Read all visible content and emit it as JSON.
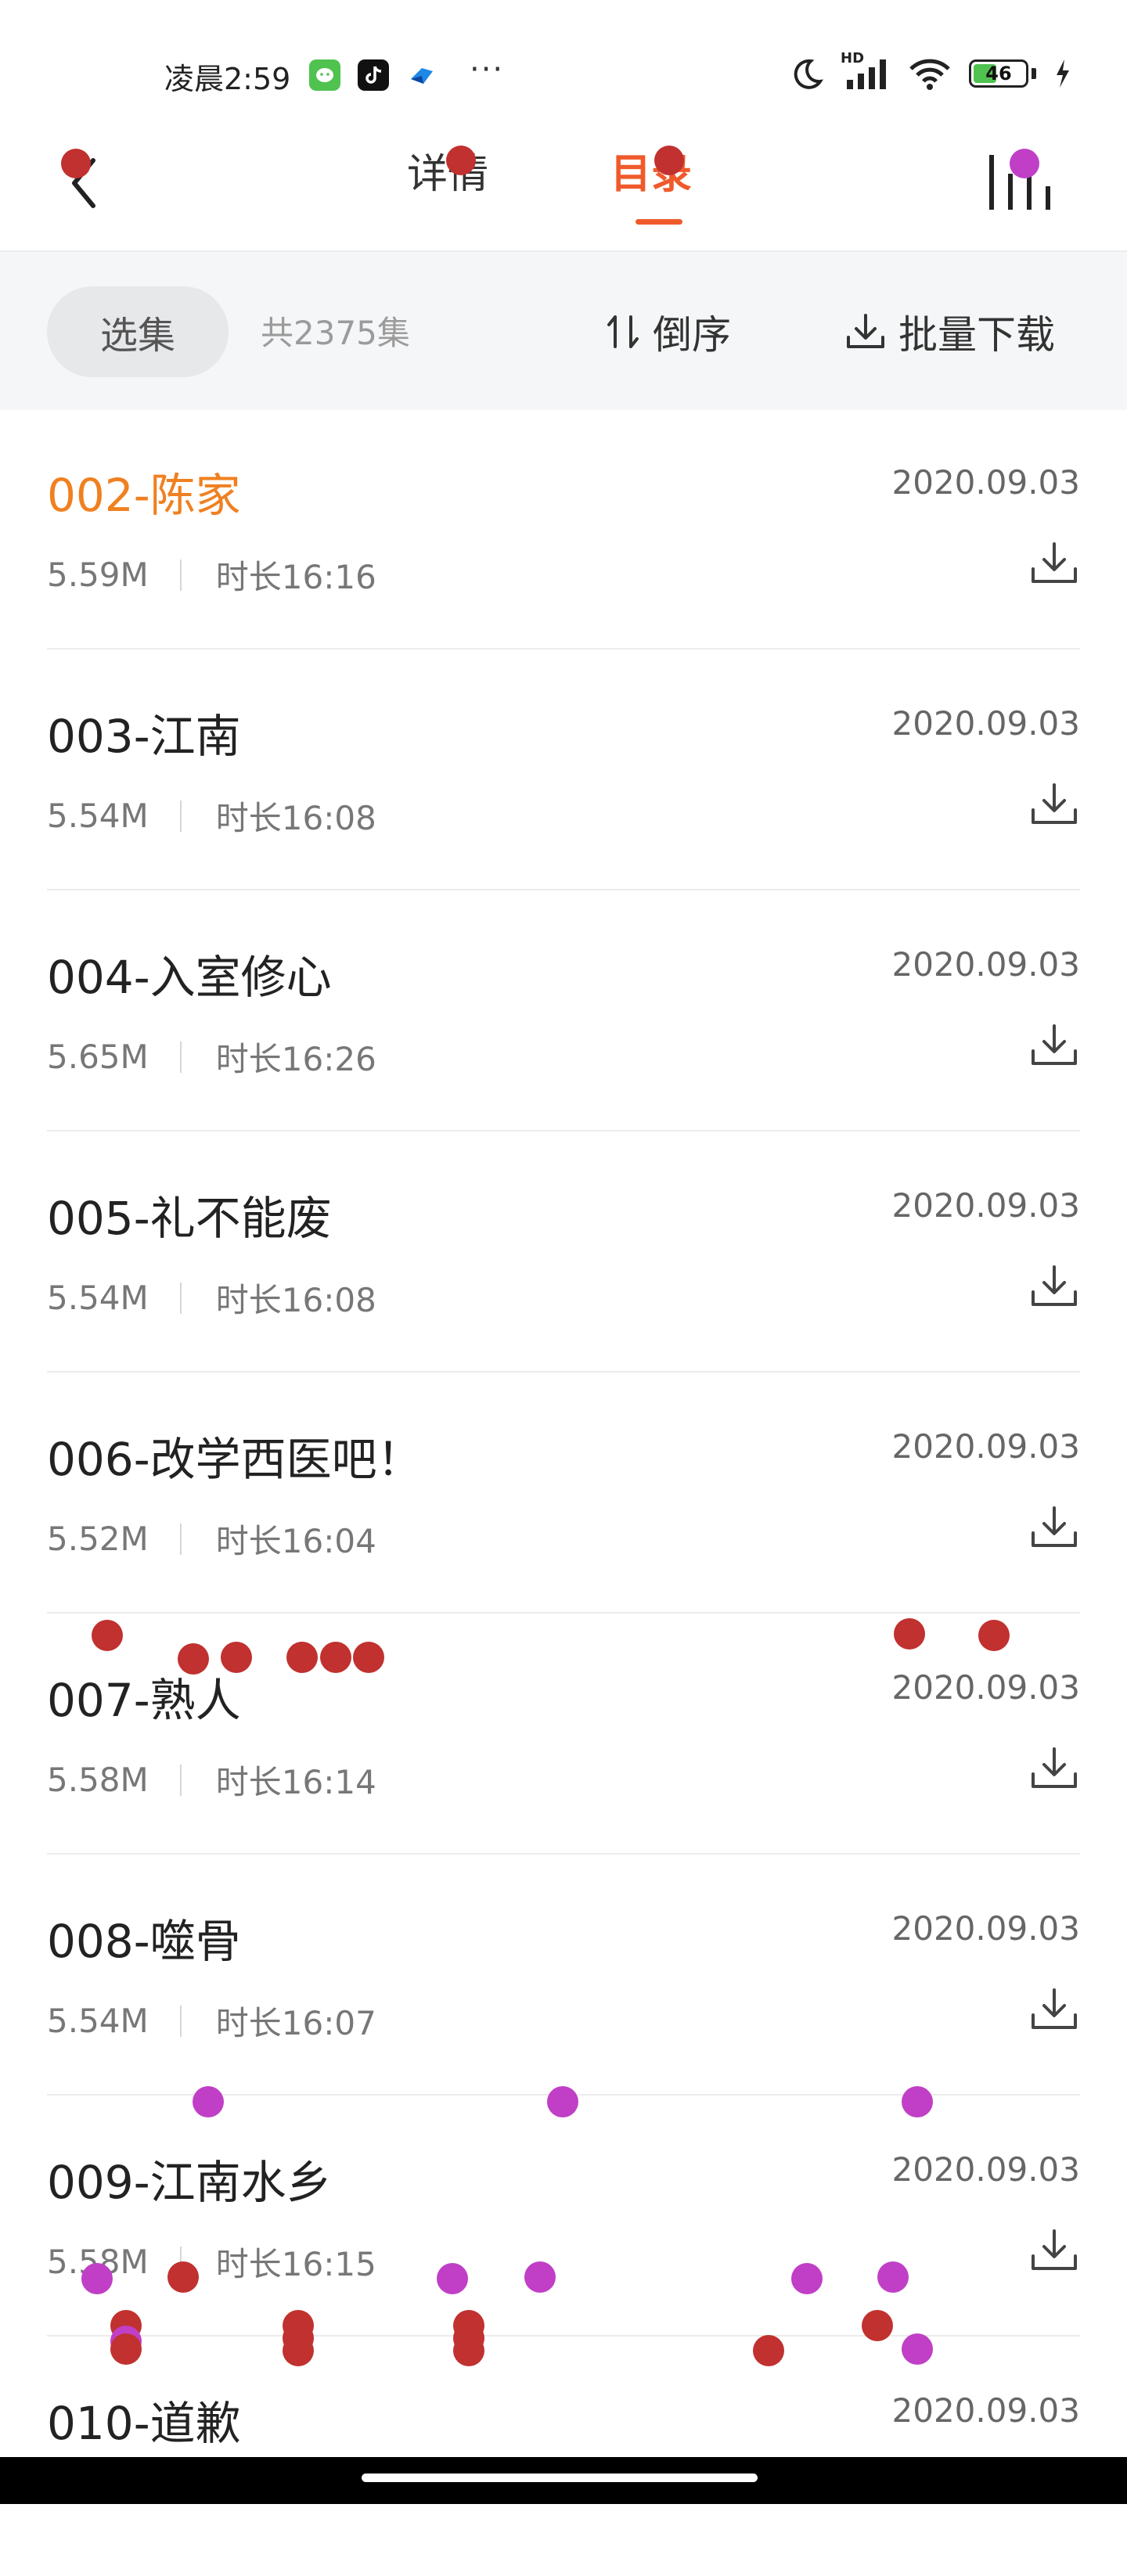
{
  "status_bar": {
    "time": "凌晨2:59",
    "more": "···",
    "network": "HD",
    "battery": "46",
    "battery_level": 0.46
  },
  "nav": {
    "tab_detail": "详情",
    "tab_catalog": "目录",
    "active_tab": "目录"
  },
  "toolbar": {
    "select_label": "选集",
    "count_text": "共2375集",
    "sort_label": "倒序",
    "batch_download_label": "批量下载"
  },
  "episodes": [
    {
      "title": "002-陈家",
      "date": "2020.09.03",
      "size": "5.59M",
      "duration": "时长16:16",
      "active": true
    },
    {
      "title": "003-江南",
      "date": "2020.09.03",
      "size": "5.54M",
      "duration": "时长16:08"
    },
    {
      "title": "004-入室修心",
      "date": "2020.09.03",
      "size": "5.65M",
      "duration": "时长16:26"
    },
    {
      "title": "005-礼不能废",
      "date": "2020.09.03",
      "size": "5.54M",
      "duration": "时长16:08"
    },
    {
      "title": "006-改学西医吧！",
      "date": "2020.09.03",
      "size": "5.52M",
      "duration": "时长16:04"
    },
    {
      "title": "007-熟人",
      "date": "2020.09.03",
      "size": "5.58M",
      "duration": "时长16:14"
    },
    {
      "title": "008-噬骨",
      "date": "2020.09.03",
      "size": "5.54M",
      "duration": "时长16:07"
    },
    {
      "title": "009-江南水乡",
      "date": "2020.09.03",
      "size": "5.58M",
      "duration": "时长16:15"
    },
    {
      "title": "010-道歉",
      "date": "2020.09.03",
      "size": "",
      "duration": ""
    }
  ],
  "colors": {
    "accent": "#f05a2b",
    "active_title": "#f08020",
    "touch_red": "#c0312f",
    "touch_magenta": "#c03fc6"
  }
}
